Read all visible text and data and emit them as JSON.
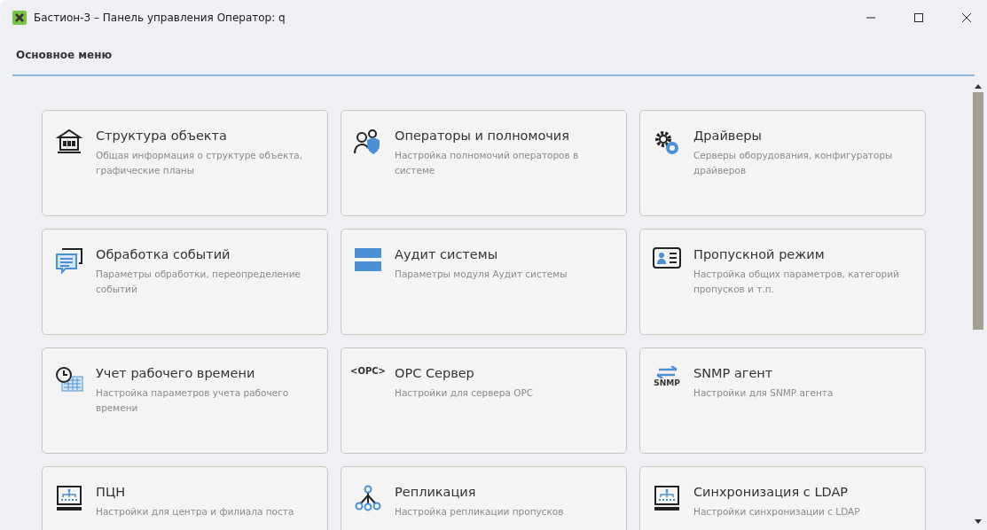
{
  "window": {
    "title": "Бастион-3 – Панель управления Оператор: q"
  },
  "header": {
    "title": "Основное меню"
  },
  "cards": [
    {
      "title": "Структура объекта",
      "description": "Общая информация о структуре объекта, графические планы"
    },
    {
      "title": "Операторы и полномочия",
      "description": "Настройка полномочий операторов в системе"
    },
    {
      "title": "Драйверы",
      "description": "Серверы оборудования, конфигураторы драйверов"
    },
    {
      "title": "Обработка событий",
      "description": "Параметры обработки, переопределение событий"
    },
    {
      "title": "Аудит системы",
      "description": "Параметры модуля Аудит системы"
    },
    {
      "title": "Пропускной режим",
      "description": "Настройка общих параметров, категорий пропусков и т.п."
    },
    {
      "title": "Учет рабочего времени",
      "description": "Настройка параметров учета рабочего времени"
    },
    {
      "icon_text": "<OPC>",
      "title": "OPC Сервер",
      "description": "Настройки для сервера OPC"
    },
    {
      "icon_text": "SNMP",
      "title": "SNMP агент",
      "description": "Настройки для SNMP агента"
    },
    {
      "title": "ПЦН",
      "description": "Настройки для центра и филиала поста"
    },
    {
      "title": "Репликация",
      "description": "Настройка репликации пропусков"
    },
    {
      "title": "Синхронизация с LDAP",
      "description": "Настройки синхронизации с LDAP"
    }
  ]
}
